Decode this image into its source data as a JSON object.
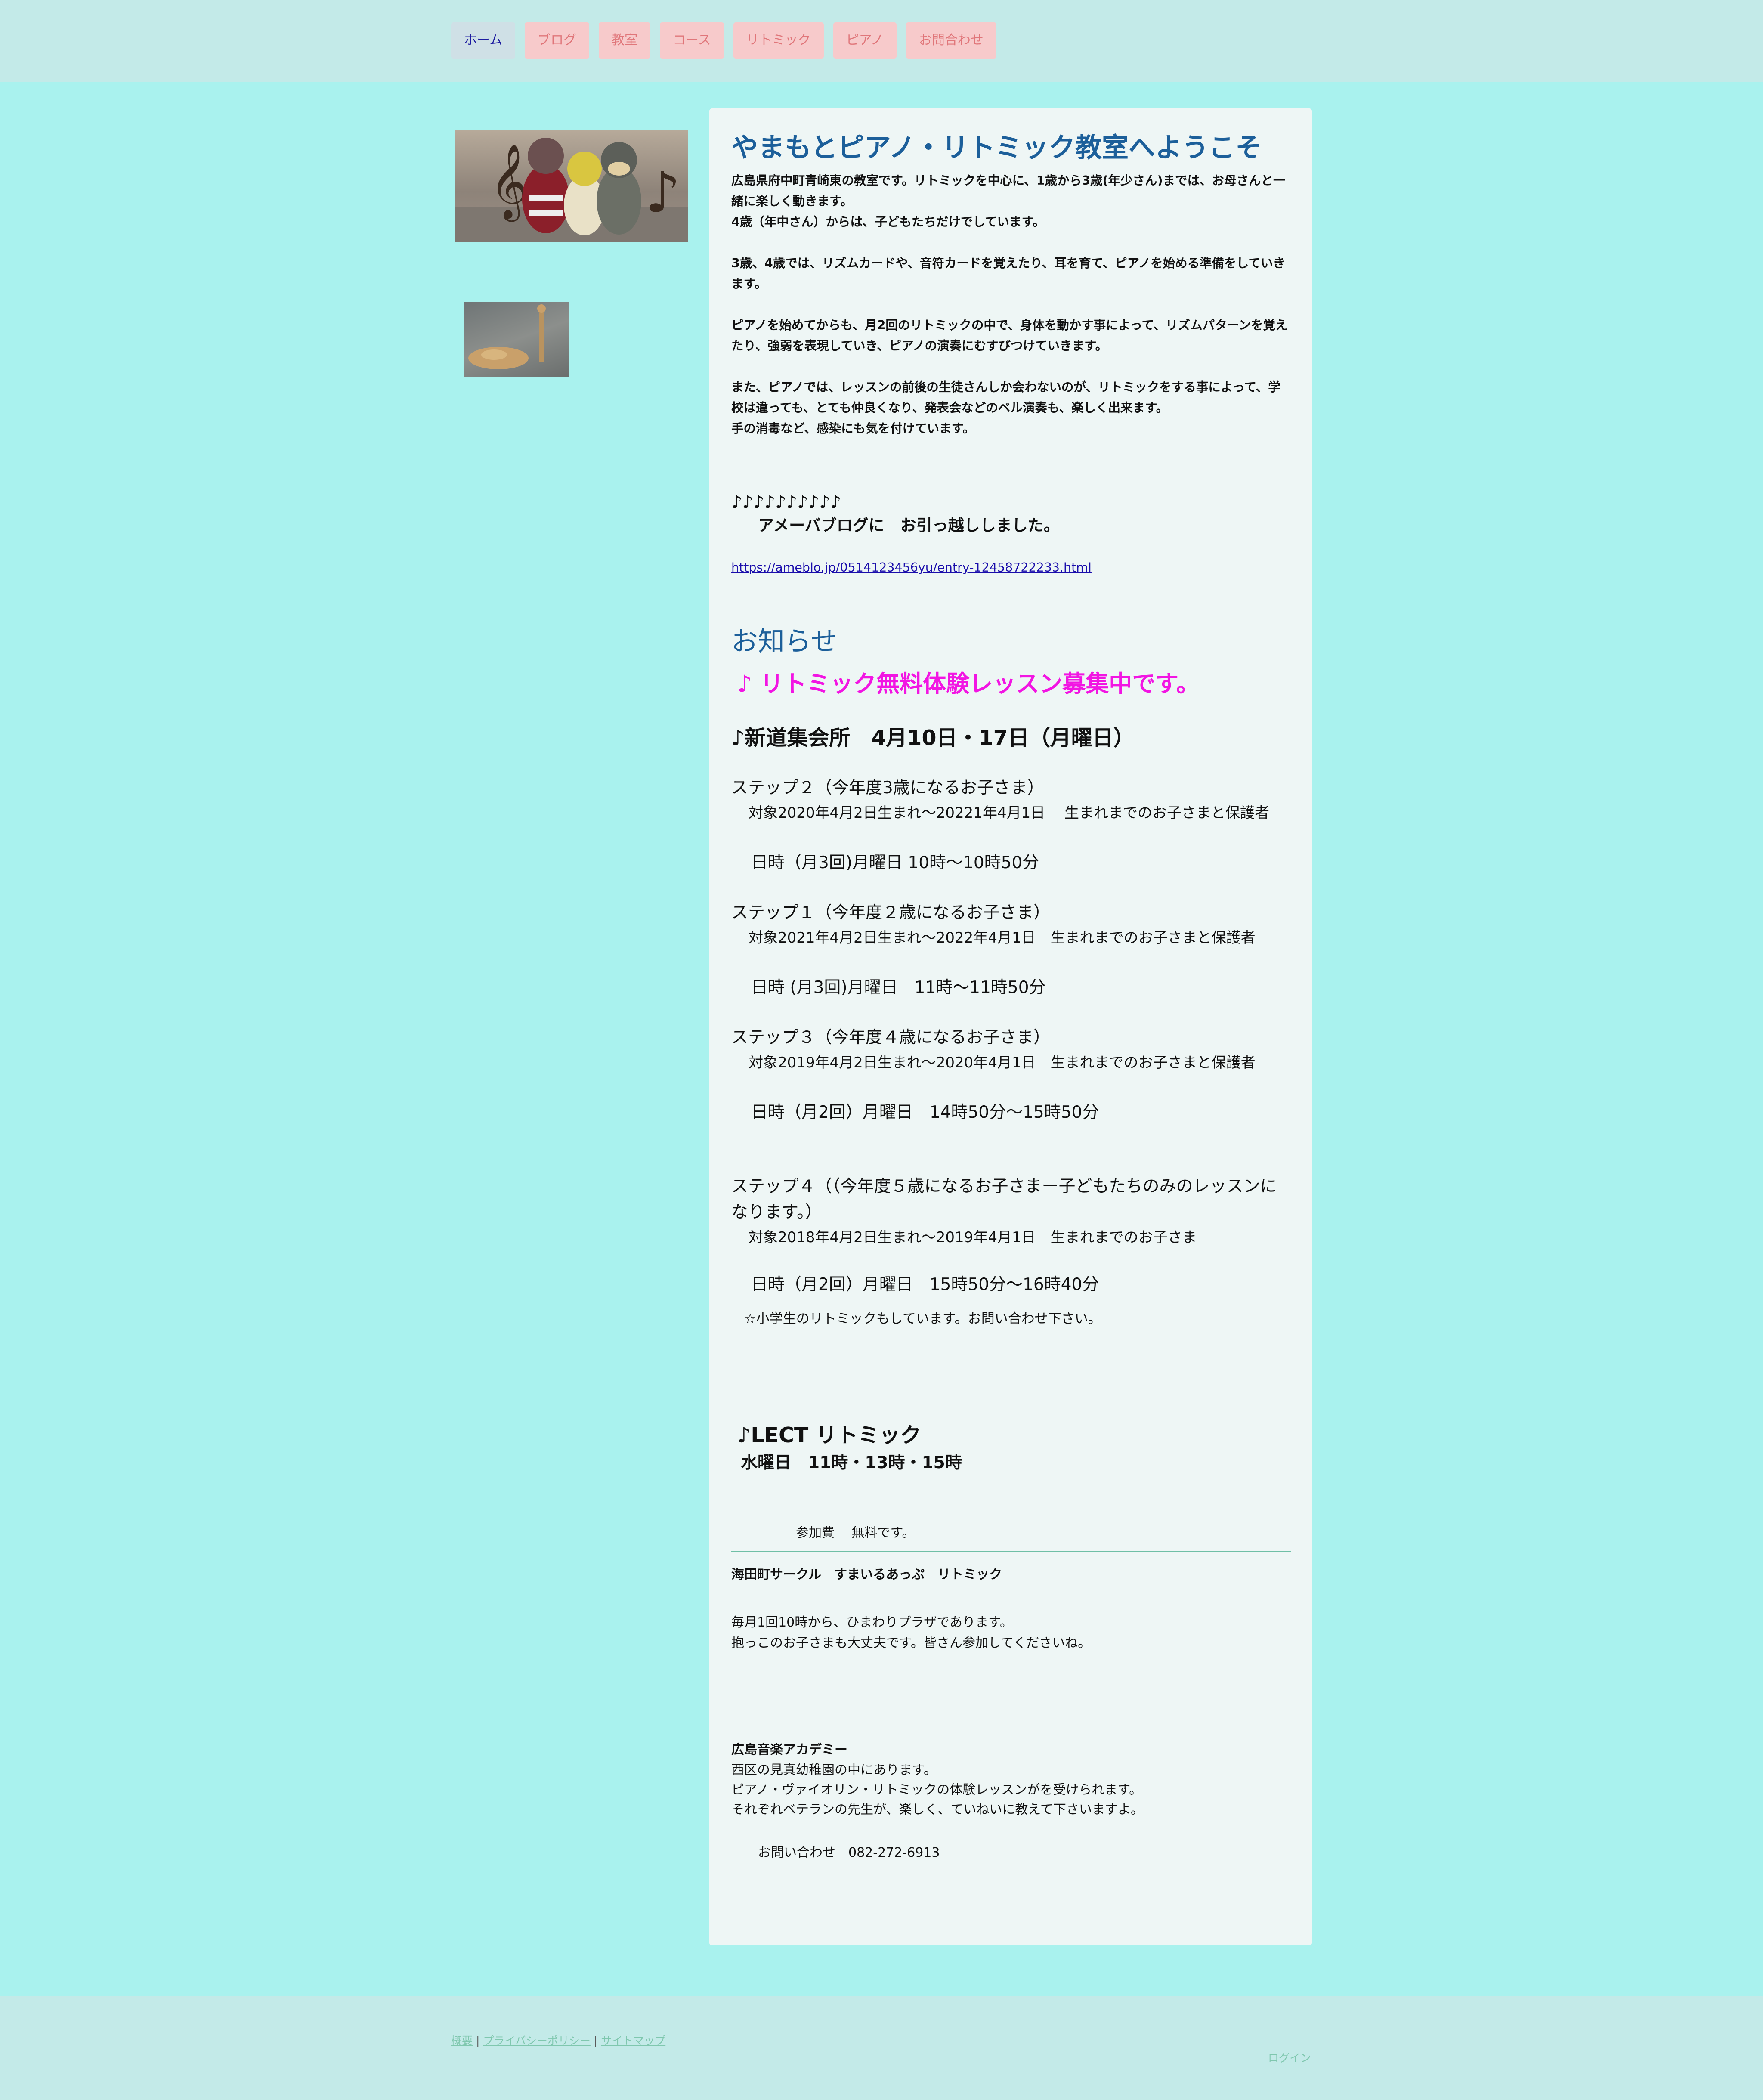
{
  "nav": {
    "items": [
      "ホーム",
      "ブログ",
      "教室",
      "コース",
      "リトミック",
      "ピアノ",
      "お問合わせ"
    ]
  },
  "main": {
    "title": "やまもとピアノ・リトミック教室へようこそ",
    "intro": [
      "広島県府中町青崎東の教室です。リトミックを中心に、1歳から3歳(年少さん)までは、お母さんと一緒に楽しく動きます。",
      "4歳（年中さん）からは、子どもたちだけでしています。",
      "",
      "3歳、4歳では、リズムカードや、音符カードを覚えたり、耳を育て、ピアノを始める準備をしていきます。",
      "",
      "ピアノを始めてからも、月2回のリトミックの中で、身体を動かす事によって、リズムパターンを覚えたり、強弱を表現していき、ピアノの演奏にむすびつけていきます。",
      "",
      "また、ピアノでは、レッスンの前後の生徒さんしか会わないのが、リトミックをする事によって、学校は違っても、とても仲良くなり、発表会などのベル演奏も、楽しく出来ます。",
      "手の消毒など、感染にも気を付けています。"
    ],
    "notes": "♪♪♪♪♪♪♪♪♪♪",
    "blog_move": "アメーバブログに　お引っ越ししました。",
    "blog_link": "https://ameblo.jp/0514123456yu/entry-12458722233.html"
  },
  "news": {
    "title": "お知らせ",
    "trial": "♪ リトミック無料体験レッスン募集中です。",
    "place": "♪新道集会所　4月10日・17日（月曜日）",
    "steps": [
      {
        "title": "ステップ２（今年度3歳になるお子さま）",
        "target": "対象2020年4月2日生まれ〜20221年4月1日　 生まれまでのお子さまと保護者",
        "time": "日時（月3回)月曜日  10時〜10時50分"
      },
      {
        "title": "ステップ１（今年度２歳になるお子さま）",
        "target": "対象2021年4月2日生まれ〜2022年4月1日　生まれまでのお子さまと保護者",
        "time": "日時  (月3回)月曜日　11時〜11時50分"
      },
      {
        "title": "ステップ３（今年度４歳になるお子さま）",
        "target": "対象2019年4月2日生まれ〜2020年4月1日　生まれまでのお子さまと保護者",
        "time": "日時（月2回）月曜日　14時50分〜15時50分"
      },
      {
        "title": "ステップ４（（今年度５歳になるお子さまー子どもたちのみのレッスンになります。）",
        "target": "対象2018年4月2日生まれ〜2019年4月1日　生まれまでのお子さま",
        "time": "日時（月2回）月曜日　15時50分〜16時40分"
      }
    ],
    "elementary_note": "☆小学生のリトミックもしています。お問い合わせ下さい。",
    "lect_title": "♪LECT  リトミック",
    "lect_time": "水曜日　11時・13時・15時",
    "fee": "参加費　 無料です。",
    "circle_title": "海田町サークル　すまいるあっぷ　リトミック",
    "circle_body": [
      "毎月1回10時から、ひまわりプラザであります。",
      "抱っこのお子さまも大丈夫です。皆さん参加してくださいね。"
    ],
    "academy_title": "広島音楽アカデミー",
    "academy_body": [
      "西区の見真幼稚園の中にあります。",
      "ピアノ・ヴァイオリン・リトミックの体験レッスンがを受けられます。",
      "それぞれベテランの先生が、楽しく、ていねいに教えて下さいますよ。"
    ],
    "contact": "お問い合わせ　082-272-6913"
  },
  "footer": {
    "links": [
      "概要",
      "プライバシーポリシー",
      "サイトマップ"
    ],
    "separator": " | ",
    "login": "ログイン"
  },
  "colors": {
    "page_bg": "#a9f2ee",
    "header_bg": "#c3eae8",
    "nav_bg": "#f7cacb",
    "nav_text": "#e0767a",
    "heading": "#1c5f9a",
    "highlight": "#f215e3",
    "footer_link": "#7fc7ae"
  }
}
